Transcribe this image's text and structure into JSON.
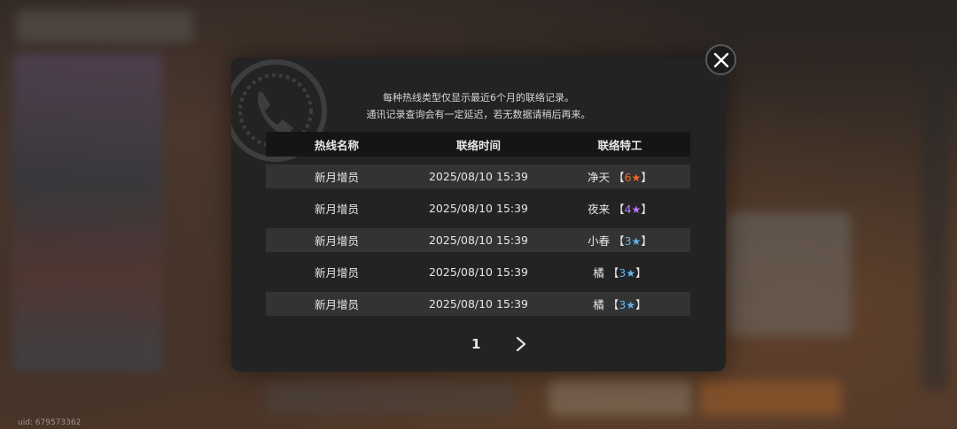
{
  "uid_text": "uid: 679573362",
  "dialog": {
    "note_line1": "每种热线类型仅显示最近6个月的联络记录。",
    "note_line2": "通讯记录查询会有一定延迟，若无数据请稍后再来。",
    "columns": [
      "热线名称",
      "联络时间",
      "联络特工"
    ],
    "rows": [
      {
        "hotline": "新月增员",
        "time": "2025/08/10 15:39",
        "agent": "净天",
        "rank": "6",
        "rank_color": "#f0672c"
      },
      {
        "hotline": "新月增员",
        "time": "2025/08/10 15:39",
        "agent": "夜来",
        "rank": "4",
        "rank_color": "#b77aff"
      },
      {
        "hotline": "新月增员",
        "time": "2025/08/10 15:39",
        "agent": "小春",
        "rank": "3",
        "rank_color": "#5fb6f0"
      },
      {
        "hotline": "新月增员",
        "time": "2025/08/10 15:39",
        "agent": "橘",
        "rank": "3",
        "rank_color": "#5fb6f0"
      },
      {
        "hotline": "新月增员",
        "time": "2025/08/10 15:39",
        "agent": "橘",
        "rank": "3",
        "rank_color": "#5fb6f0"
      }
    ],
    "bracket_open": "【",
    "bracket_close": "】",
    "star_glyph": "★",
    "page": "1"
  },
  "icons": {
    "close": "close-icon",
    "next": "chevron-right-icon",
    "decor": "phone-icon"
  }
}
